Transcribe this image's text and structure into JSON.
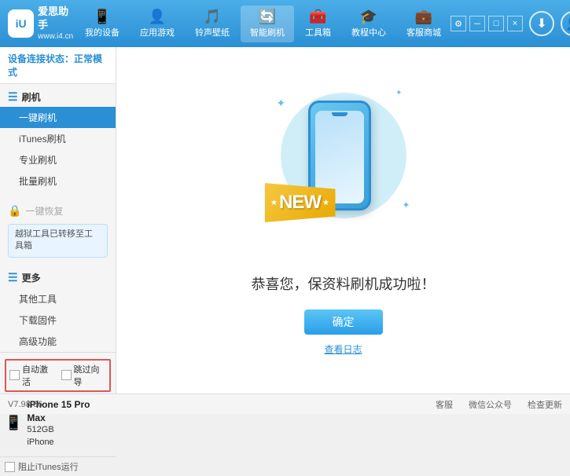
{
  "app": {
    "logo_text1": "爱思助手",
    "logo_text2": "www.i4.cn",
    "logo_abbr": "iU"
  },
  "nav": {
    "items": [
      {
        "id": "my-device",
        "icon": "📱",
        "label": "我的设备"
      },
      {
        "id": "apps-games",
        "icon": "👤",
        "label": "应用游戏"
      },
      {
        "id": "ringtones",
        "icon": "🎵",
        "label": "铃声壁纸"
      },
      {
        "id": "smart-flash",
        "icon": "🔄",
        "label": "智能刷机",
        "active": true
      },
      {
        "id": "toolbox",
        "icon": "🧰",
        "label": "工具箱"
      },
      {
        "id": "tutorial",
        "icon": "🎓",
        "label": "教程中心"
      },
      {
        "id": "service",
        "icon": "💼",
        "label": "客服商城"
      }
    ]
  },
  "sidebar": {
    "status_label": "设备连接状态：",
    "status_value": "正常模式",
    "flash_section": "刷机",
    "items": [
      {
        "id": "one-key-flash",
        "label": "一键刷机",
        "active": true
      },
      {
        "id": "itunes-flash",
        "label": "iTunes刷机"
      },
      {
        "id": "pro-flash",
        "label": "专业刷机"
      },
      {
        "id": "batch-flash",
        "label": "批量刷机"
      }
    ],
    "one_key_restore_label": "一键恢复",
    "restore_disabled": true,
    "warning_text": "越狱工具已转移至工具箱",
    "more_section": "更多",
    "more_items": [
      {
        "id": "other-tools",
        "label": "其他工具"
      },
      {
        "id": "download-firmware",
        "label": "下载固件"
      },
      {
        "id": "advanced",
        "label": "高级功能"
      }
    ],
    "auto_activate_label": "自动激活",
    "guide_import_label": "跳过向导",
    "device_name": "iPhone 15 Pro Max",
    "device_storage": "512GB",
    "device_type": "iPhone",
    "itunes_label": "阻止iTunes运行"
  },
  "main": {
    "success_text": "恭喜您，保资料刷机成功啦！",
    "confirm_btn": "确定",
    "log_link": "查看日志",
    "new_badge": "NEW",
    "phone_description": "Flash success illustration"
  },
  "footer": {
    "version": "V7.98.66",
    "items": [
      "客服",
      "微信公众号",
      "检查更新"
    ]
  },
  "window_controls": {
    "minimize": "－",
    "maximize": "□",
    "close": "×"
  }
}
